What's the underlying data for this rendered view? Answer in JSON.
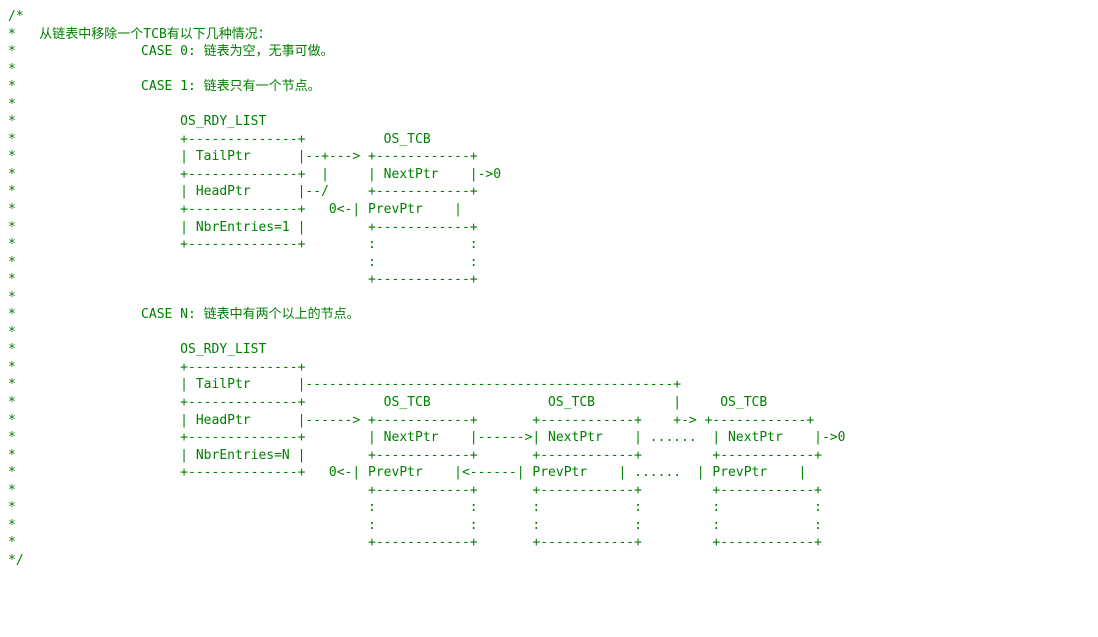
{
  "lines": [
    "/*",
    "*   从链表中移除一个TCB有以下几种情况：",
    "*                CASE 0: 链表为空，无事可做。",
    "*",
    "*                CASE 1: 链表只有一个节点。",
    "*",
    "*                     OS_RDY_LIST",
    "*                     +--------------+          OS_TCB",
    "*                     | TailPtr      |--+---> +------------+",
    "*                     +--------------+  |     | NextPtr    |->0",
    "*                     | HeadPtr      |--/     +------------+",
    "*                     +--------------+   0<-| PrevPtr    |",
    "*                     | NbrEntries=1 |        +------------+",
    "*                     +--------------+        :            :",
    "*                                             :            :",
    "*                                             +------------+",
    "*",
    "*                CASE N: 链表中有两个以上的节点。",
    "*",
    "*                     OS_RDY_LIST",
    "*                     +--------------+",
    "*                     | TailPtr      |-----------------------------------------------+",
    "*                     +--------------+          OS_TCB               OS_TCB          |     OS_TCB",
    "*                     | HeadPtr      |------> +------------+       +------------+    +-> +------------+",
    "*                     +--------------+        | NextPtr    |------>| NextPtr    | ......  | NextPtr    |->0",
    "*                     | NbrEntries=N |        +------------+       +------------+         +------------+",
    "*                     +--------------+   0<-| PrevPtr    |<------| PrevPtr    | ......  | PrevPtr    |",
    "*                                             +------------+       +------------+         +------------+",
    "*                                             :            :       :            :         :            :",
    "*                                             :            :       :            :         :            :",
    "*                                             +------------+       +------------+         +------------+",
    "*/"
  ]
}
